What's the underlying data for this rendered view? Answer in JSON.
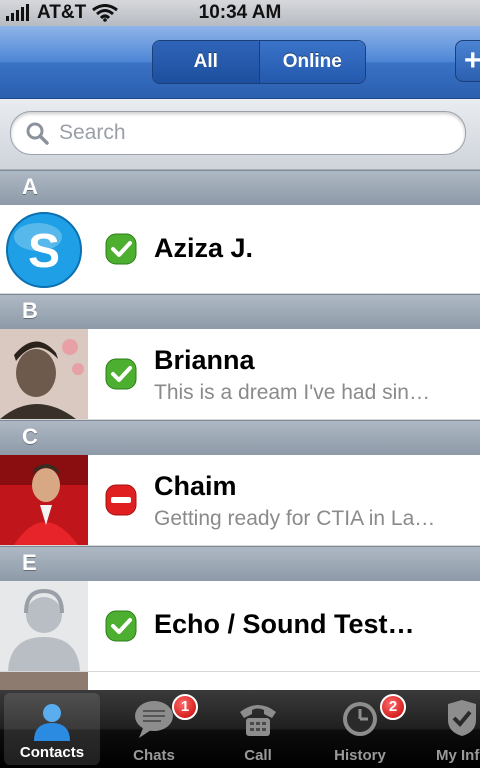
{
  "status_bar": {
    "carrier": "AT&T",
    "time": "10:34 AM"
  },
  "nav": {
    "segments": [
      "All",
      "Online"
    ],
    "selected": "All",
    "add_label": "+"
  },
  "search": {
    "placeholder": "Search"
  },
  "sections": [
    {
      "letter": "A",
      "contacts": [
        {
          "name": "Aziza J.",
          "message": "",
          "status": "online",
          "avatar": "skype-logo"
        }
      ]
    },
    {
      "letter": "B",
      "contacts": [
        {
          "name": "Brianna",
          "message": "This is a dream I've had sin…",
          "status": "online",
          "avatar": "photo"
        }
      ]
    },
    {
      "letter": "C",
      "contacts": [
        {
          "name": "Chaim",
          "message": "Getting ready for CTIA in La…",
          "status": "do-not-disturb",
          "avatar": "photo"
        }
      ]
    },
    {
      "letter": "E",
      "contacts": [
        {
          "name": "Echo / Sound Test…",
          "message": "",
          "status": "online",
          "avatar": "silhouette"
        }
      ]
    }
  ],
  "tabs": [
    {
      "label": "Contacts",
      "icon": "person-icon",
      "badge": ""
    },
    {
      "label": "Chats",
      "icon": "chat-bubble-icon",
      "badge": "1"
    },
    {
      "label": "Call",
      "icon": "phone-icon",
      "badge": ""
    },
    {
      "label": "History",
      "icon": "clock-icon",
      "badge": "2"
    },
    {
      "label": "My Inf",
      "icon": "shield-check-icon",
      "badge": ""
    }
  ],
  "colors": {
    "nav_blue": "#3a72c4",
    "online_green": "#4caf2f",
    "dnd_red": "#e02020",
    "skype_blue": "#1fa0e6"
  }
}
